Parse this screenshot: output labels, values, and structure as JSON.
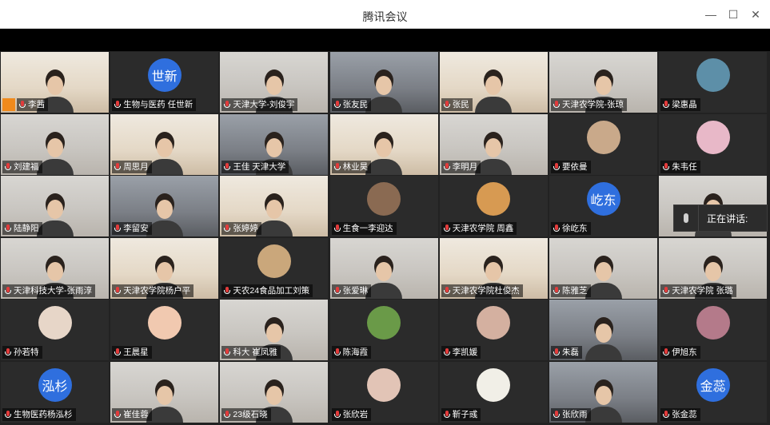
{
  "window": {
    "title": "腾讯会议",
    "controls": {
      "minimize": "—",
      "maximize": "☐",
      "close": "✕"
    }
  },
  "speaking_panel": {
    "label": "正在讲话:"
  },
  "participants": [
    {
      "name": "李茜",
      "kind": "video",
      "tone": "warm"
    },
    {
      "name": "生物与医药  任世新",
      "kind": "avatar",
      "avatar_text": "世新",
      "color": "#2f6fde"
    },
    {
      "name": "天津大学-刘俊宇",
      "kind": "video"
    },
    {
      "name": "张友民",
      "kind": "video",
      "tone": "dark"
    },
    {
      "name": "张民",
      "kind": "video",
      "tone": "warm"
    },
    {
      "name": "天津农学院-张琼",
      "kind": "video"
    },
    {
      "name": "梁惠晶",
      "kind": "avatar",
      "avatar_text": "",
      "color": "#5d8fa8"
    },
    {
      "name": "刘建福",
      "kind": "video"
    },
    {
      "name": "周思月",
      "kind": "video",
      "tone": "warm"
    },
    {
      "name": "王佳 天津大学",
      "kind": "video",
      "tone": "dark"
    },
    {
      "name": "林业昊",
      "kind": "video",
      "tone": "warm"
    },
    {
      "name": "李明月",
      "kind": "video"
    },
    {
      "name": "要依曼",
      "kind": "avatar",
      "avatar_text": "",
      "color": "#c9a98a"
    },
    {
      "name": "朱韦任",
      "kind": "avatar",
      "avatar_text": "",
      "color": "#e8b8c8"
    },
    {
      "name": "陆静阳",
      "kind": "video"
    },
    {
      "name": "李留安",
      "kind": "video",
      "tone": "dark"
    },
    {
      "name": "张婷婷",
      "kind": "video",
      "tone": "warm"
    },
    {
      "name": "生食一李迎达",
      "kind": "avatar",
      "avatar_text": "",
      "color": "#8a6a52"
    },
    {
      "name": "天津农学院 周鑫",
      "kind": "avatar",
      "avatar_text": "",
      "color": "#d79a52"
    },
    {
      "name": "徐屹东",
      "kind": "avatar",
      "avatar_text": "屹东",
      "color": "#2f6fde"
    },
    {
      "name": "",
      "kind": "video"
    },
    {
      "name": "天津科技大学-张雨淳",
      "kind": "video"
    },
    {
      "name": "天津农学院杨户平",
      "kind": "video",
      "tone": "warm"
    },
    {
      "name": "天农24食品加工刘策",
      "kind": "avatar",
      "avatar_text": "",
      "color": "#caa77b"
    },
    {
      "name": "张爱琳",
      "kind": "video"
    },
    {
      "name": "天津农学院杜俊杰",
      "kind": "video",
      "tone": "warm"
    },
    {
      "name": "陈雅芝",
      "kind": "video"
    },
    {
      "name": "天津农学院 张璐",
      "kind": "video"
    },
    {
      "name": "孙若特",
      "kind": "avatar",
      "avatar_text": "",
      "color": "#e7d6c8"
    },
    {
      "name": "王晨星",
      "kind": "avatar",
      "avatar_text": "",
      "color": "#f1c9b0"
    },
    {
      "name": "科大 崔凤雅",
      "kind": "video"
    },
    {
      "name": "陈海霞",
      "kind": "avatar",
      "avatar_text": "",
      "color": "#6a9a48"
    },
    {
      "name": "李凯媛",
      "kind": "avatar",
      "avatar_text": "",
      "color": "#d4b0a0"
    },
    {
      "name": "朱磊",
      "kind": "video",
      "tone": "dark"
    },
    {
      "name": "伊旭东",
      "kind": "avatar",
      "avatar_text": "",
      "color": "#b47a8a"
    },
    {
      "name": "生物医药杨泓杉",
      "kind": "avatar",
      "avatar_text": "泓杉",
      "color": "#2f6fde"
    },
    {
      "name": "崔佳蓉",
      "kind": "video"
    },
    {
      "name": "23级石晓",
      "kind": "video"
    },
    {
      "name": "张欣岩",
      "kind": "avatar",
      "avatar_text": "",
      "color": "#e2c4b6"
    },
    {
      "name": "靳子彧",
      "kind": "avatar",
      "avatar_text": "",
      "color": "#f1efe7"
    },
    {
      "name": "张欣雨",
      "kind": "video",
      "tone": "dark"
    },
    {
      "name": "张金蕊",
      "kind": "avatar",
      "avatar_text": "金蕊",
      "color": "#2f6fde"
    }
  ]
}
